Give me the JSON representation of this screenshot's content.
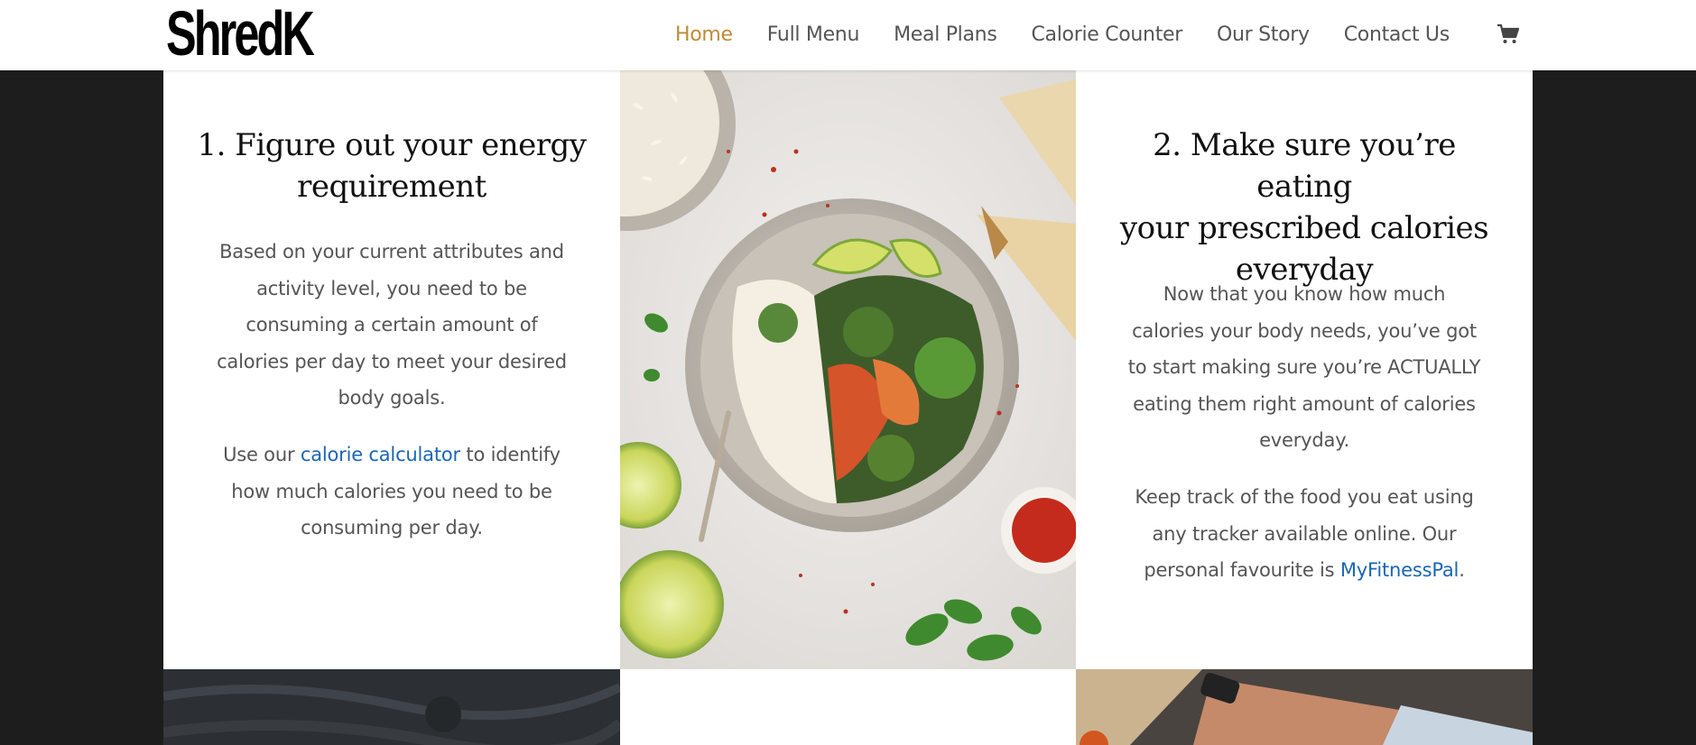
{
  "header": {
    "logo": "ShredK",
    "nav": [
      {
        "label": "Home",
        "active": true
      },
      {
        "label": "Full Menu"
      },
      {
        "label": "Meal Plans"
      },
      {
        "label": "Calorie Counter"
      },
      {
        "label": "Our Story"
      },
      {
        "label": "Contact Us"
      }
    ],
    "cart_icon": "shopping-cart-icon",
    "active_color": "#c08b36"
  },
  "section1": {
    "heading_line1": "1. Figure out your energy",
    "heading_line2": "requirement",
    "para1_lines": [
      "Based on your current attributes and",
      "activity level, you need to be",
      "consuming a certain amount of",
      "calories per day to meet your desired",
      "body goals."
    ],
    "para2_prefix": "Use our ",
    "para2_link": "calorie calculator",
    "para2_suffix_line1": " to identify",
    "para2_line2": "how much calories you need to be",
    "para2_line3": "consuming per day."
  },
  "section2": {
    "heading_line1": "2. Make sure you’re eating",
    "heading_line2": "your prescribed calories",
    "heading_line3": "everyday",
    "para1_lines": [
      "Now that you know how much",
      "calories your body needs, you’ve got",
      "to start making sure you’re ACTUALLY",
      "eating them right amount of calories",
      "everyday."
    ],
    "para2_line1": "Keep track of the food you eat using",
    "para2_line2": "any tracker available online. Our",
    "para2_prefix3": "personal favourite is ",
    "para2_link": "MyFitnessPal",
    "para2_suffix3": "."
  },
  "colors": {
    "link": "#1a66b5",
    "body_text": "#555555",
    "page_background": "#1d1d1d"
  }
}
